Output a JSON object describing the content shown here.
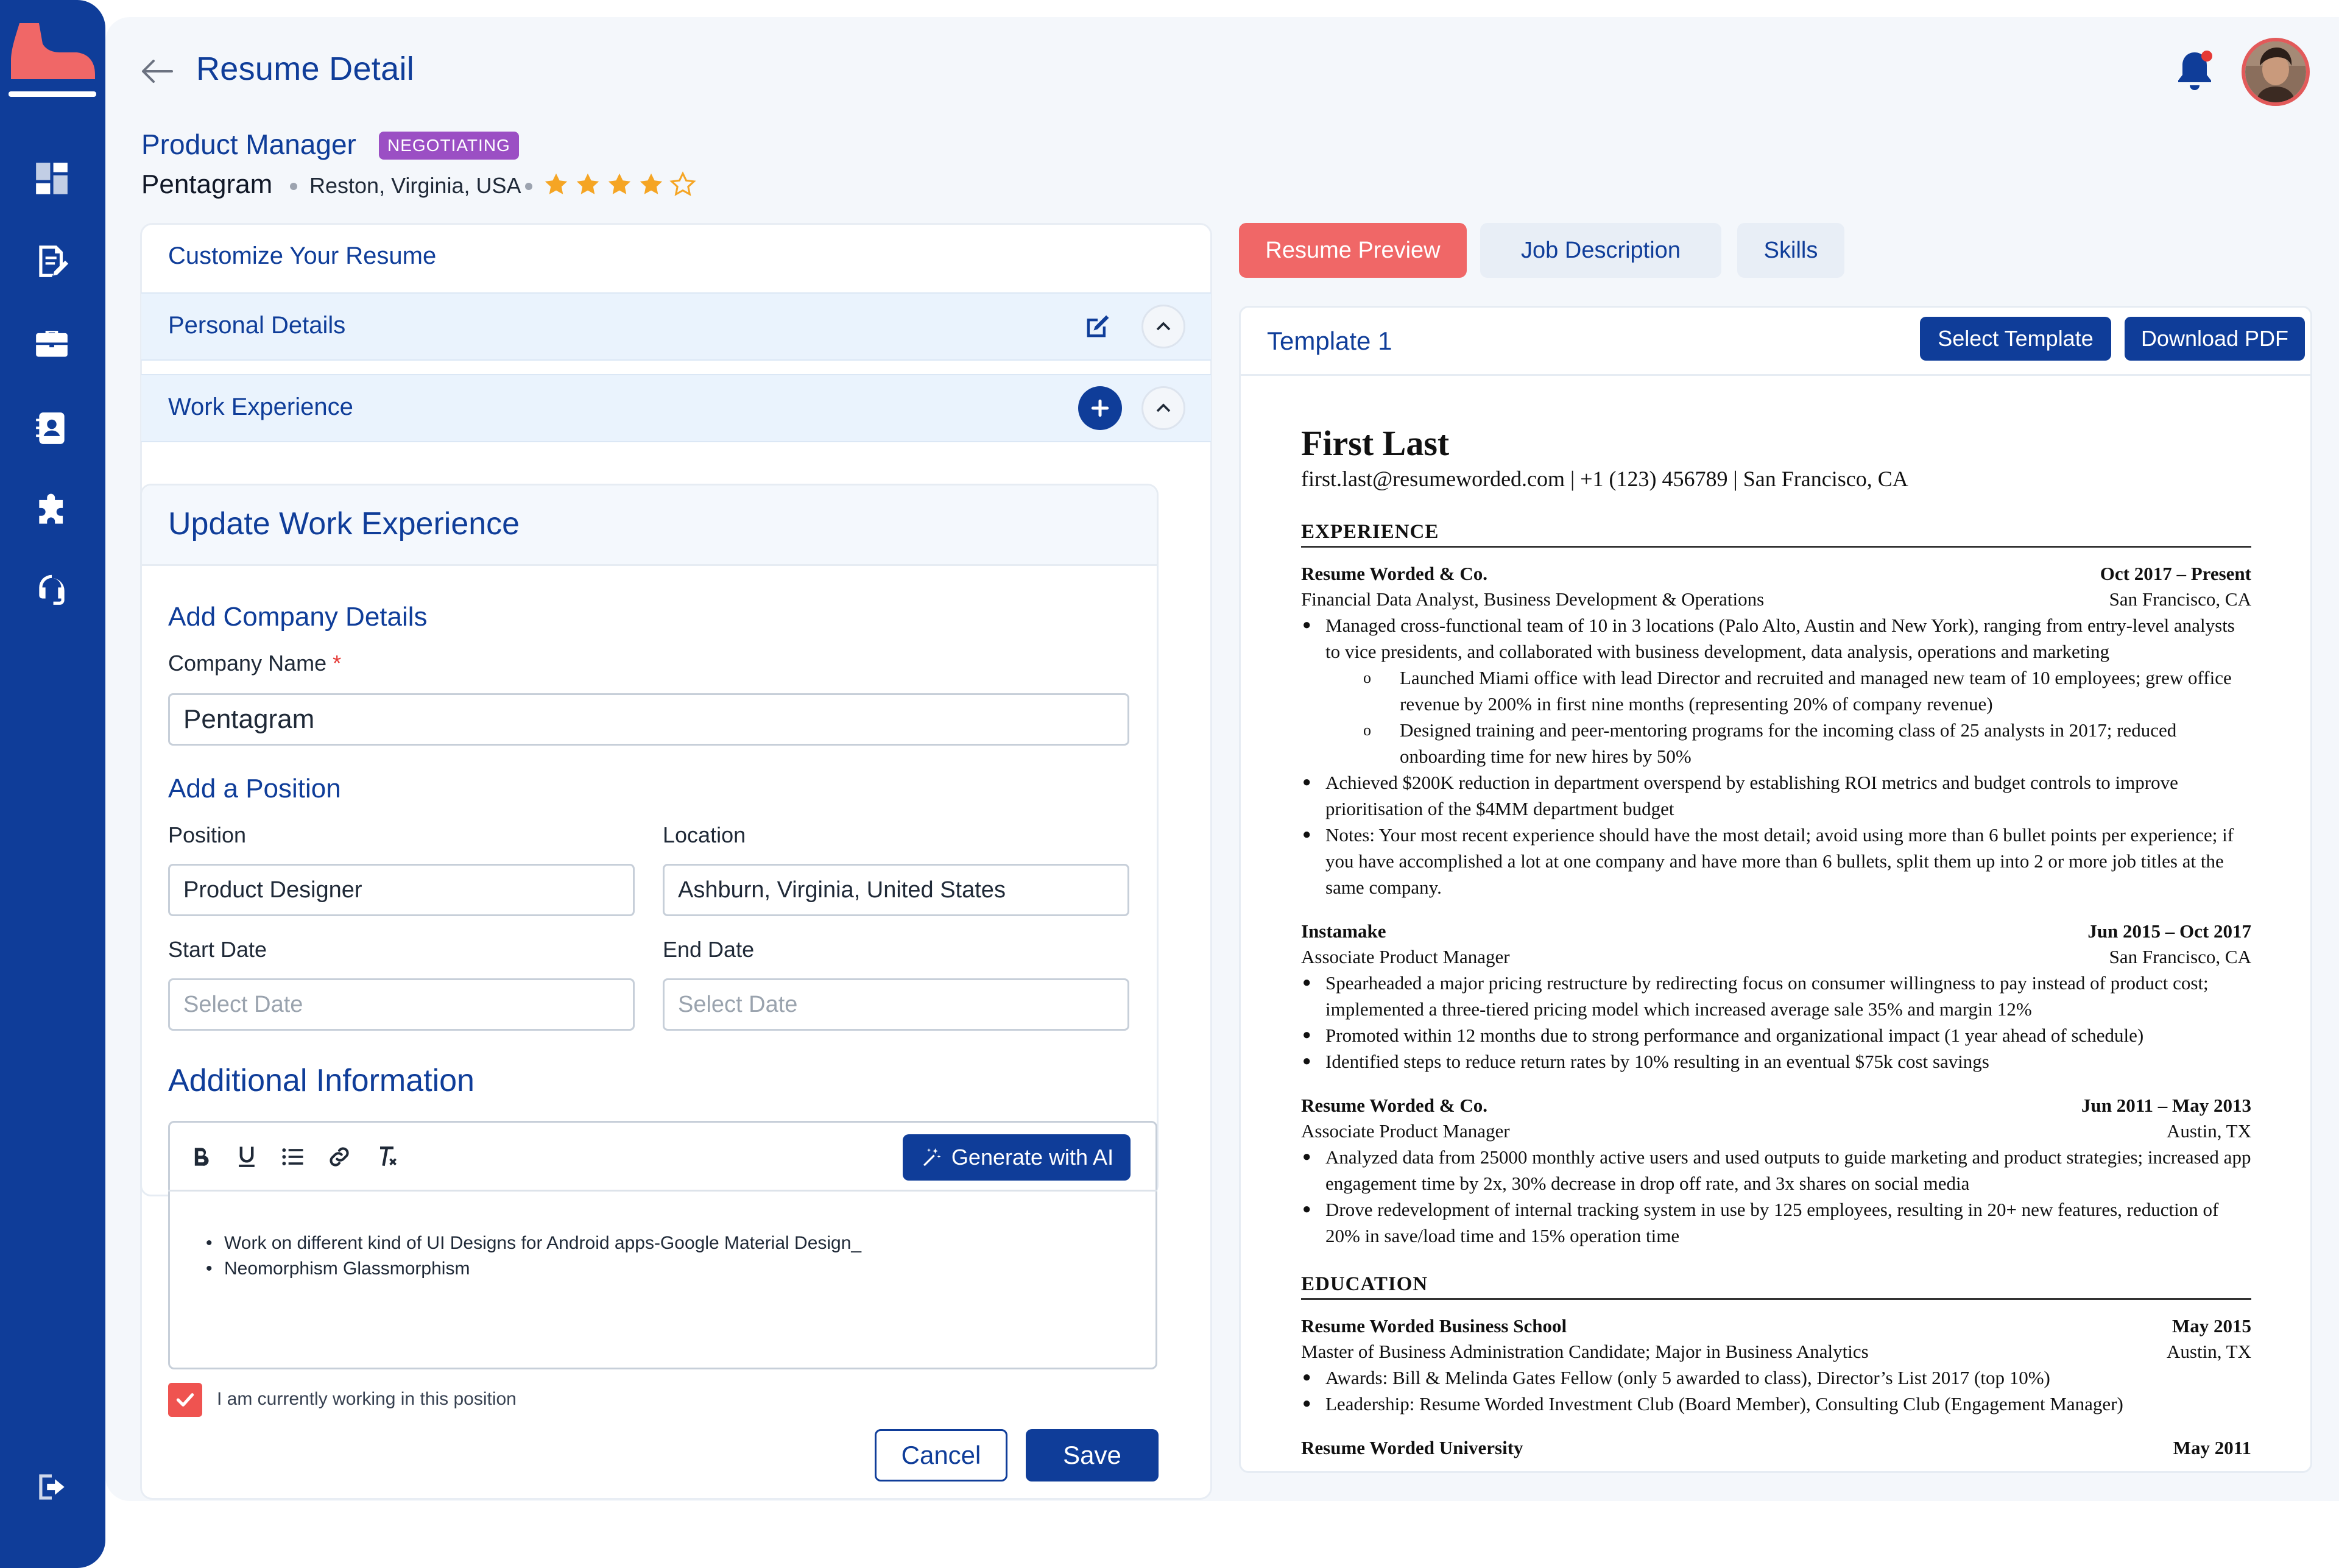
{
  "header": {
    "page_title": "Resume Detail",
    "job_title": "Product Manager",
    "status_badge": "NEGOTIATING",
    "company": "Pentagram",
    "location": "Reston, Virginia, USA",
    "rating": 4,
    "rating_max": 5
  },
  "colors": {
    "brand": "#0f3d99",
    "accent": "#f06767",
    "badge": "#9b4fc4",
    "star": "#f5a524"
  },
  "sidebar": {
    "items": [
      {
        "icon": "dashboard-icon"
      },
      {
        "icon": "edit-document-icon"
      },
      {
        "icon": "briefcase-icon"
      },
      {
        "icon": "contacts-icon"
      },
      {
        "icon": "puzzle-icon"
      },
      {
        "icon": "headset-icon"
      },
      {
        "icon": "logout-icon"
      }
    ]
  },
  "left": {
    "customize_title": "Customize Your Resume",
    "personal_details": "Personal Details",
    "work_experience": "Work Experience",
    "update_title": "Update Work Experience",
    "add_company_title": "Add Company Details",
    "company_name_label": "Company Name",
    "required_mark": "*",
    "company_name_value": "Pentagram",
    "add_position_title": "Add a Position",
    "position_label": "Position",
    "position_value": "Product Designer",
    "location_label": "Location",
    "location_value": "Ashburn, Virginia, United States",
    "start_date_label": "Start Date",
    "start_date_placeholder": "Select Date",
    "end_date_label": "End Date",
    "end_date_placeholder": "Select Date",
    "additional_title": "Additional Information",
    "generate_label": "Generate with AI",
    "editor_lines": [
      "Work on different kind of UI Designs for Android apps-Google Material Design_",
      "Neomorphism Glassmorphism"
    ],
    "currently_working_label": "I am currently working in this position",
    "currently_working": true,
    "cancel_label": "Cancel",
    "save_label": "Save"
  },
  "right": {
    "tabs": [
      "Resume Preview",
      "Job Description",
      "Skills"
    ],
    "active_tab": "Resume Preview",
    "template_title": "Template 1",
    "select_template_label": "Select Template",
    "download_pdf_label": "Download PDF"
  },
  "resume": {
    "name": "First Last",
    "contact": "first.last@resumeworded.com  |  +1 (123) 456789  |  San Francisco, CA",
    "experience_heading": "EXPERIENCE",
    "jobs": [
      {
        "company": "Resume Worded & Co.",
        "dates": "Oct 2017 – Present",
        "role": "Financial Data Analyst, Business Development & Operations",
        "location": "San Francisco, CA",
        "b1": "Managed cross-functional team of 10 in 3 locations (Palo Alto, Austin and New York), ranging from entry-level analysts to vice presidents, and collaborated with business development, data analysis, operations and marketing",
        "s1": "Launched Miami office with lead Director and recruited and managed new team of 10 employees; grew office revenue by 200% in first nine months (representing 20% of company revenue)",
        "s2": "Designed training and peer-mentoring programs for the incoming class of 25 analysts in 2017; reduced onboarding time for new hires by 50%",
        "b2": "Achieved $200K reduction in department overspend by establishing ROI metrics and budget controls to improve prioritisation of the $4MM department budget",
        "b3": "Notes: Your most recent experience should have the most detail; avoid using more than 6 bullet points per experience; if you have accomplished a lot at one company and have more than 6 bullets, split them up into 2 or more job titles at the same company."
      },
      {
        "company": "Instamake",
        "dates": "Jun 2015 – Oct 2017",
        "role": "Associate Product Manager",
        "location": "San Francisco, CA",
        "b1": "Spearheaded a major pricing restructure by redirecting focus on consumer willingness to pay instead of product cost; implemented a three-tiered pricing model which increased average sale 35% and margin 12%",
        "b2": "Promoted within 12 months due to strong performance and organizational impact (1 year ahead of schedule)",
        "b3": "Identified steps to reduce return rates by 10% resulting in an eventual $75k cost savings"
      },
      {
        "company": "Resume Worded & Co.",
        "dates": "Jun 2011 – May 2013",
        "role": "Associate Product Manager",
        "location": "Austin, TX",
        "b1": "Analyzed data from 25000 monthly active users and used outputs to guide marketing and product strategies; increased app engagement time by 2x, 30% decrease in drop off rate, and 3x shares on social media",
        "b2": "Drove redevelopment of internal tracking system in use by 125 employees, resulting in 20+ new features, reduction of 20% in save/load time and 15% operation time"
      }
    ],
    "education_heading": "EDUCATION",
    "schools": [
      {
        "name": "Resume Worded Business School",
        "date": "May 2015",
        "degree": "Master of Business Administration Candidate; Major in Business Analytics",
        "location": "Austin, TX",
        "b1": "Awards: Bill & Melinda Gates Fellow (only 5 awarded to class), Director’s List 2017 (top 10%)",
        "b2": "Leadership: Resume Worded Investment Club (Board Member), Consulting Club (Engagement Manager)"
      },
      {
        "name": "Resume Worded University",
        "date": "May 2011"
      }
    ]
  }
}
